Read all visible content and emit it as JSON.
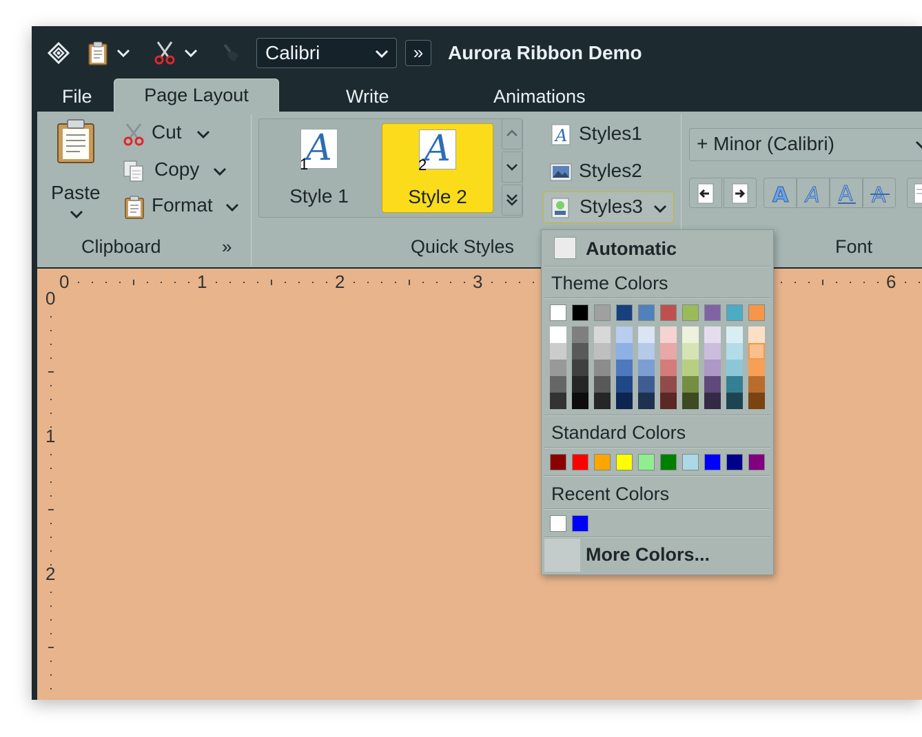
{
  "window": {
    "title": "Aurora Ribbon Demo"
  },
  "title_bar": {
    "app_icon": "diamond-menu-icon",
    "font_combo_value": "Calibri",
    "overflow_label": "»"
  },
  "tabs": [
    {
      "label": "File",
      "selected": false
    },
    {
      "label": "Page Layout",
      "selected": true
    },
    {
      "label": "Write",
      "selected": false
    },
    {
      "label": "Animations",
      "selected": false
    }
  ],
  "clipboard": {
    "paste_label": "Paste",
    "cut_label": "Cut",
    "copy_label": "Copy",
    "format_label": "Format",
    "band_title": "Clipboard",
    "expand_label": "»"
  },
  "quick_styles": {
    "styles": [
      {
        "label": "Style 1",
        "number": "1",
        "selected": false
      },
      {
        "label": "Style 2",
        "number": "2",
        "selected": true
      }
    ],
    "glyph": "A",
    "list": [
      {
        "label": "Styles1",
        "icon": "text-style-icon"
      },
      {
        "label": "Styles2",
        "icon": "image-style-icon"
      },
      {
        "label": "Styles3",
        "icon": "color-style-icon"
      }
    ],
    "band_title": "Quick Styles"
  },
  "font": {
    "font_name": "+ Minor (Calibri)",
    "band_title": "Font"
  },
  "ruler": {
    "horizontal_numbers": [
      "0",
      "1",
      "2",
      "3",
      "6"
    ],
    "vertical_numbers": [
      "0",
      "1",
      "2"
    ]
  },
  "color_popup": {
    "automatic_label": "Automatic",
    "theme_colors_label": "Theme Colors",
    "standard_colors_label": "Standard Colors",
    "recent_colors_label": "Recent Colors",
    "more_colors_label": "More Colors...",
    "automatic_color": "#ebebeb",
    "theme_top": [
      "#ffffff",
      "#000000",
      "#a0a0a0",
      "#17407e",
      "#4f81bd",
      "#c0504d",
      "#9bbb59",
      "#8064a2",
      "#4bacc6",
      "#f79646"
    ],
    "theme_columns": [
      [
        "#ffffff",
        "#cccccc",
        "#999999",
        "#666666",
        "#333333"
      ],
      [
        "#7f7f7f",
        "#595959",
        "#404040",
        "#262626",
        "#0d0d0d"
      ],
      [
        "#d8d8d8",
        "#bfbfbf",
        "#8c8c8c",
        "#595959",
        "#262626"
      ],
      [
        "#b9cdf0",
        "#8eb0e4",
        "#4f79bf",
        "#1f4886",
        "#0e2451"
      ],
      [
        "#dae4f3",
        "#b5c9e8",
        "#7b9fd2",
        "#3e5e92",
        "#1f3151"
      ],
      [
        "#f5d3d2",
        "#e7a8a7",
        "#d37c79",
        "#914c49",
        "#5c2826"
      ],
      [
        "#ecf2db",
        "#d6e4b5",
        "#b8cf82",
        "#758e41",
        "#3e4a22"
      ],
      [
        "#e5dded",
        "#cbbddb",
        "#ad98c6",
        "#5f4a7b",
        "#352a45"
      ],
      [
        "#d9eef4",
        "#b2dde8",
        "#8cc7d8",
        "#357f93",
        "#1d4551"
      ],
      [
        "#fcdfc5",
        "#f9c08c",
        "#f6a057",
        "#b96d2d",
        "#794410"
      ]
    ],
    "standard": [
      "#8b0000",
      "#ff0000",
      "#ffa500",
      "#ffff00",
      "#90ee90",
      "#008000",
      "#add8e6",
      "#0000ff",
      "#00008b",
      "#800080"
    ],
    "recent": [
      "#ffffff",
      "#0000ff"
    ],
    "highlight_color": "#f79646"
  }
}
